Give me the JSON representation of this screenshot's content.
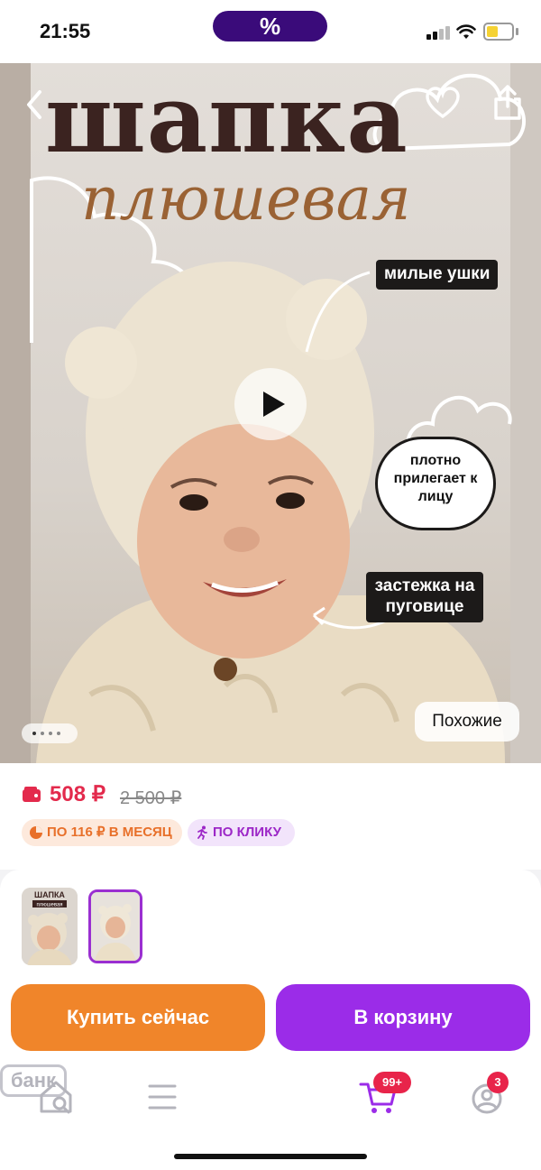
{
  "status_bar": {
    "time": "21:55",
    "promo_label": "%"
  },
  "hero": {
    "title": "шапка",
    "subtitle": "плюшевая",
    "tags": {
      "ears": "милые ушки",
      "fit": "плотно прилегает к лицу",
      "clasp": "застежка на пуговице"
    },
    "similar_label": "Похожие",
    "slides_count": 4,
    "active_slide": 1
  },
  "price": {
    "current": "508 ₽",
    "old": "2 500 ₽",
    "installment_badge": "ПО 116 ₽ В МЕСЯЦ",
    "click_badge": "ПО КЛИКУ"
  },
  "thumbnails": {
    "first_title": "ШАПКА",
    "first_subtitle": "плюшевая"
  },
  "actions": {
    "buy_now": "Купить сейчас",
    "add_to_cart": "В корзину"
  },
  "bottom_nav": {
    "bank_label": "банк",
    "cart_badge": "99+",
    "profile_badge": "3"
  },
  "colors": {
    "price_red": "#e32a4c",
    "buy_orange": "#f0852a",
    "cart_purple": "#9b2ce8",
    "badge_red": "#e8244a"
  }
}
